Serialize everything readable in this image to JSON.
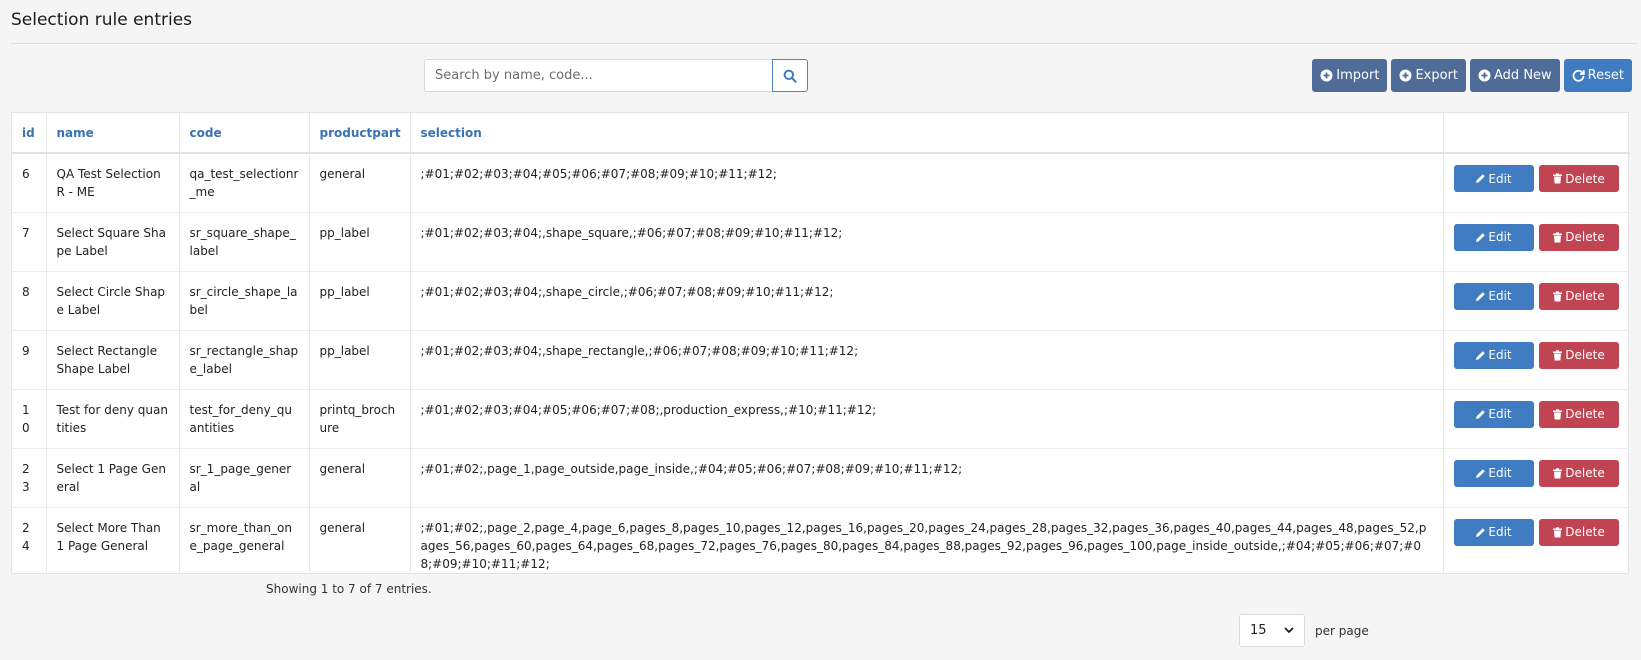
{
  "page": {
    "title": "Selection rule entries"
  },
  "search": {
    "placeholder": "Search by name, code..."
  },
  "toolbar": {
    "import_label": "Import",
    "export_label": "Export",
    "add_new_label": "Add New",
    "reset_label": "Reset"
  },
  "table": {
    "columns": [
      "id",
      "name",
      "code",
      "productpart",
      "selection",
      ""
    ],
    "rows": [
      {
        "id": "6",
        "name": "QA Test SelectionR - ME",
        "code": "qa_test_selectionr_me",
        "productpart": "general",
        "selection": ";#01;#02;#03;#04;#05;#06;#07;#08;#09;#10;#11;#12;"
      },
      {
        "id": "7",
        "name": "Select Square Shape Label",
        "code": "sr_square_shape_label",
        "productpart": "pp_label",
        "selection": ";#01;#02;#03;#04;,shape_square,;#06;#07;#08;#09;#10;#11;#12;"
      },
      {
        "id": "8",
        "name": "Select Circle Shape Label",
        "code": "sr_circle_shape_label",
        "productpart": "pp_label",
        "selection": ";#01;#02;#03;#04;,shape_circle,;#06;#07;#08;#09;#10;#11;#12;"
      },
      {
        "id": "9",
        "name": "Select Rectangle Shape Label",
        "code": "sr_rectangle_shape_label",
        "productpart": "pp_label",
        "selection": ";#01;#02;#03;#04;,shape_rectangle,;#06;#07;#08;#09;#10;#11;#12;"
      },
      {
        "id": "10",
        "name": "Test for deny quantities",
        "code": "test_for_deny_quantities",
        "productpart": "printq_brochure",
        "selection": ";#01;#02;#03;#04;#05;#06;#07;#08;,production_express,;#10;#11;#12;"
      },
      {
        "id": "23",
        "name": "Select 1 Page General",
        "code": "sr_1_page_general",
        "productpart": "general",
        "selection": ";#01;#02;,page_1,page_outside,page_inside,;#04;#05;#06;#07;#08;#09;#10;#11;#12;"
      },
      {
        "id": "24",
        "name": "Select More Than 1 Page General",
        "code": "sr_more_than_one_page_general",
        "productpart": "general",
        "selection": ";#01;#02;,page_2,page_4,page_6,pages_8,pages_10,pages_12,pages_16,pages_20,pages_24,pages_28,pages_32,pages_36,pages_40,pages_44,pages_48,pages_52,pages_56,pages_60,pages_64,pages_68,pages_72,pages_76,pages_80,pages_84,pages_88,pages_92,pages_96,pages_100,page_inside_outside,;#04;#05;#06;#07;#08;#09;#10;#11;#12;"
      }
    ],
    "edit_label": "Edit",
    "delete_label": "Delete"
  },
  "footer": {
    "info": "Showing 1 to 7 of 7 entries.",
    "per_page_value": "15",
    "per_page_label": "per page"
  },
  "colors": {
    "primary": "#3f7cc1",
    "slate": "#4f6b98",
    "danger": "#c04452",
    "header_link": "#3a72b5"
  },
  "icons": {
    "search": "search-icon",
    "import": "plus-circle-icon",
    "export": "plus-circle-icon",
    "add_new": "plus-circle-icon",
    "reset": "refresh-icon",
    "edit": "pencil-icon",
    "delete": "trash-icon",
    "select": "chevron-down-icon"
  }
}
